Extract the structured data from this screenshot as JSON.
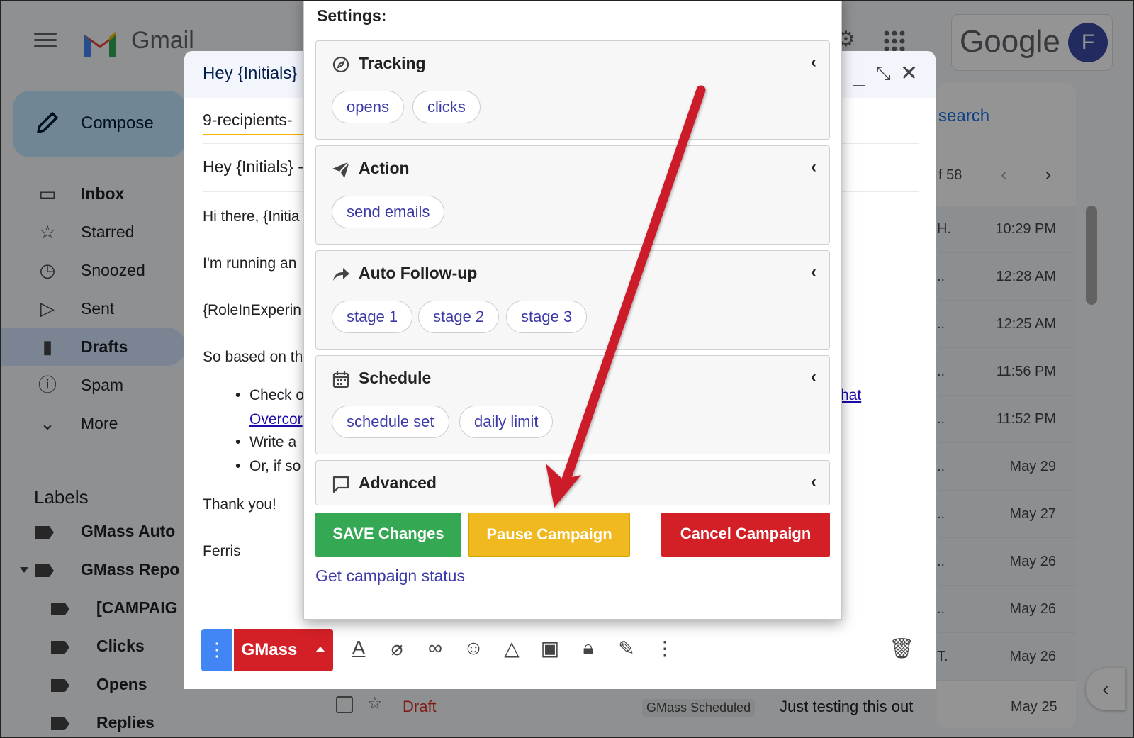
{
  "gmail": {
    "wordmark": "Gmail",
    "google_wordmark": "Google",
    "avatar_initial": "F",
    "compose_label": "Compose"
  },
  "sidebar": {
    "items": [
      {
        "label": "Inbox",
        "icon": "inbox-icon"
      },
      {
        "label": "Starred",
        "icon": "star-icon"
      },
      {
        "label": "Snoozed",
        "icon": "clock-icon"
      },
      {
        "label": "Sent",
        "icon": "send-icon"
      },
      {
        "label": "Drafts",
        "icon": "draft-icon",
        "active": true
      },
      {
        "label": "Spam",
        "icon": "spam-icon"
      },
      {
        "label": "More",
        "icon": "chevron-down-icon"
      }
    ],
    "labels_heading": "Labels",
    "labels": [
      "GMass Auto",
      "GMass Repo",
      "[CAMPAIG",
      "Clicks",
      "Opens",
      "Replies"
    ]
  },
  "list": {
    "search_fragment": "search",
    "count_fragment": "f 58",
    "rows": [
      {
        "sender_fragment": "H.",
        "time": "10:29 PM"
      },
      {
        "sender_fragment": "..",
        "time": "12:28 AM"
      },
      {
        "sender_fragment": "..",
        "time": "12:25 AM"
      },
      {
        "sender_fragment": "..",
        "time": "11:56 PM"
      },
      {
        "sender_fragment": "..",
        "time": "11:52 PM"
      },
      {
        "sender_fragment": "..",
        "time": "May 29"
      },
      {
        "sender_fragment": "..",
        "time": "May 27"
      },
      {
        "sender_fragment": "..",
        "time": "May 26"
      },
      {
        "sender_fragment": "..",
        "time": "May 26"
      },
      {
        "sender_fragment": "T.",
        "time": "May 26"
      }
    ],
    "bottom_row": {
      "status": "Draft",
      "label": "GMass Scheduled",
      "snippet": "Just testing this out",
      "time": "May 25"
    }
  },
  "compose_window": {
    "title": "Hey {Initials}",
    "to": "9-recipients-",
    "subject": "Hey {Initials} -",
    "body": {
      "greeting": "Hi there, {Initia",
      "line2": "I'm running an",
      "line3": "{RoleInExperin",
      "line4": "So based on th",
      "bullet1": "Check o",
      "bullet1_link": "Overcor",
      "bullet1_right_link": "hat",
      "bullet2": "Write a",
      "bullet3": "Or, if so",
      "thanks": "Thank you!",
      "signature": "Ferris"
    },
    "gmass_button": "GMass"
  },
  "settings": {
    "title": "Settings:",
    "panels": [
      {
        "title": "Tracking",
        "icon": "compass-icon",
        "pills": [
          "opens",
          "clicks"
        ]
      },
      {
        "title": "Action",
        "icon": "paper-plane-icon",
        "pills": [
          "send emails"
        ]
      },
      {
        "title": "Auto Follow-up",
        "icon": "reply-arrow-icon",
        "pills": [
          "stage 1",
          "stage 2",
          "stage 3"
        ]
      },
      {
        "title": "Schedule",
        "icon": "calendar-icon",
        "pills": [
          "schedule set",
          "daily limit"
        ]
      },
      {
        "title": "Advanced",
        "icon": "comment-icon",
        "pills": []
      }
    ],
    "buttons": {
      "save": "SAVE Changes",
      "pause": "Pause Campaign",
      "cancel": "Cancel Campaign"
    },
    "status_link": "Get campaign status"
  },
  "colors": {
    "save": "#34a853",
    "pause": "#f0b91f",
    "cancel": "#d32027",
    "pill_text": "#3d3aa8",
    "annotation_arrow": "#cc1f2a"
  }
}
